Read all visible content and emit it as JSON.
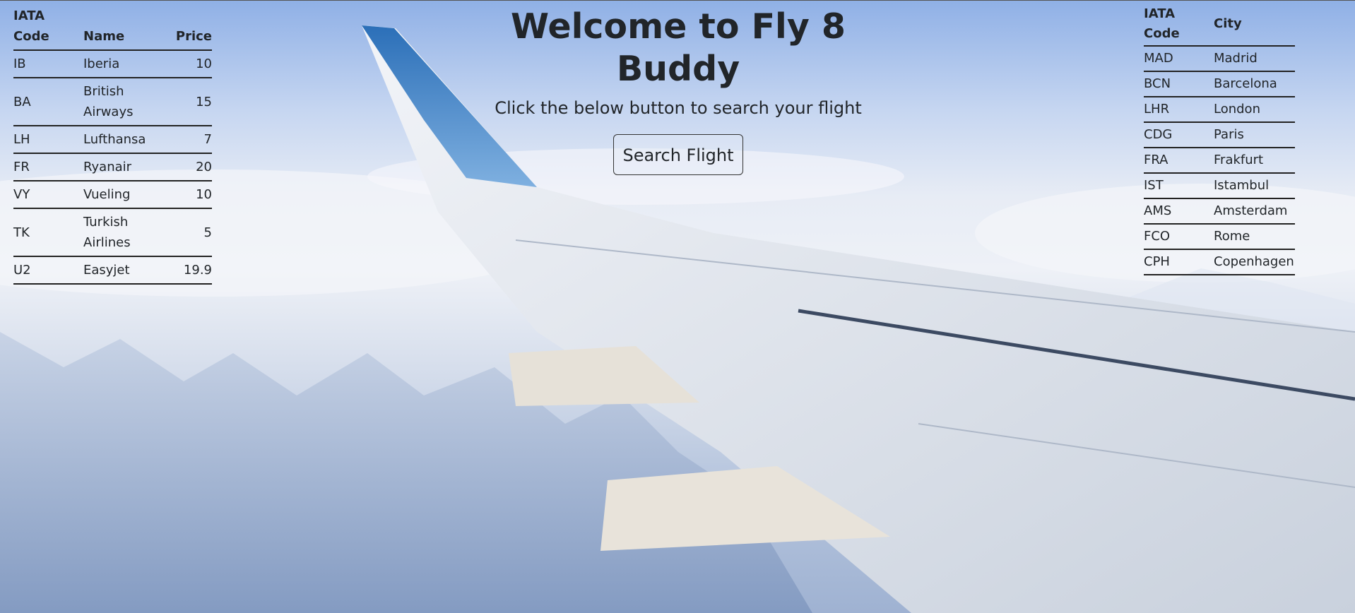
{
  "hero": {
    "title": "Welcome to Fly 8 Buddy",
    "subtitle": "Click the below button to search your flight",
    "search_button_label": "Search Flight"
  },
  "airlines_table": {
    "headers": [
      "IATA Code",
      "Name",
      "Price"
    ],
    "rows": [
      {
        "code": "IB",
        "name": "Iberia",
        "price": "10"
      },
      {
        "code": "BA",
        "name": "British Airways",
        "price": "15"
      },
      {
        "code": "LH",
        "name": "Lufthansa",
        "price": "7"
      },
      {
        "code": "FR",
        "name": "Ryanair",
        "price": "20"
      },
      {
        "code": "VY",
        "name": "Vueling",
        "price": "10"
      },
      {
        "code": "TK",
        "name": "Turkish Airlines",
        "price": "5"
      },
      {
        "code": "U2",
        "name": "Easyjet",
        "price": "19.9"
      }
    ]
  },
  "cities_table": {
    "headers": [
      "IATA Code",
      "City"
    ],
    "rows": [
      {
        "code": "MAD",
        "city": "Madrid"
      },
      {
        "code": "BCN",
        "city": "Barcelona"
      },
      {
        "code": "LHR",
        "city": "London"
      },
      {
        "code": "CDG",
        "city": "Paris"
      },
      {
        "code": "FRA",
        "city": "Frakfurt"
      },
      {
        "code": "IST",
        "city": "Istambul"
      },
      {
        "code": "AMS",
        "city": "Amsterdam"
      },
      {
        "code": "FCO",
        "city": "Rome"
      },
      {
        "code": "CPH",
        "city": "Copenhagen"
      }
    ]
  },
  "colors": {
    "text": "#212529",
    "sky_top": "#8fb0e6",
    "wing": "#e9edf3",
    "winglet_blue": "#3d7fc6"
  }
}
